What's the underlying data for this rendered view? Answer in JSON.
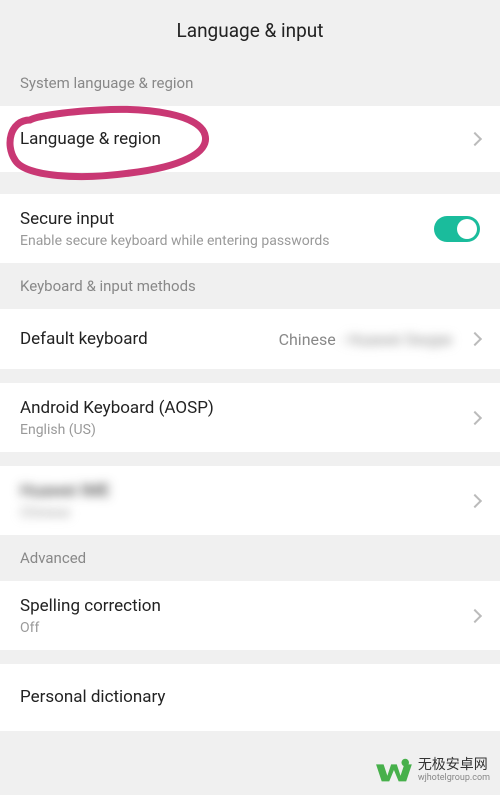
{
  "header": {
    "title": "Language & input"
  },
  "sections": {
    "system_language": "System language & region",
    "keyboard_methods": "Keyboard & input methods",
    "advanced": "Advanced"
  },
  "items": {
    "language_region": {
      "title": "Language & region"
    },
    "secure_input": {
      "title": "Secure input",
      "subtitle": "Enable secure keyboard while entering passwords",
      "enabled": true
    },
    "default_keyboard": {
      "title": "Default keyboard",
      "value": "Chinese"
    },
    "aosp_keyboard": {
      "title": "Android Keyboard (AOSP)",
      "subtitle": "English (US)"
    },
    "blurred_keyboard": {
      "title": "Hidden",
      "subtitle": "Chinese"
    },
    "spelling": {
      "title": "Spelling correction",
      "subtitle": "Off"
    },
    "dictionary": {
      "title": "Personal dictionary"
    }
  },
  "watermark": {
    "cn": "无极安卓网",
    "url": "wjhotelgroup.com"
  },
  "colors": {
    "accent": "#1abc9c",
    "highlight": "#c93874"
  }
}
